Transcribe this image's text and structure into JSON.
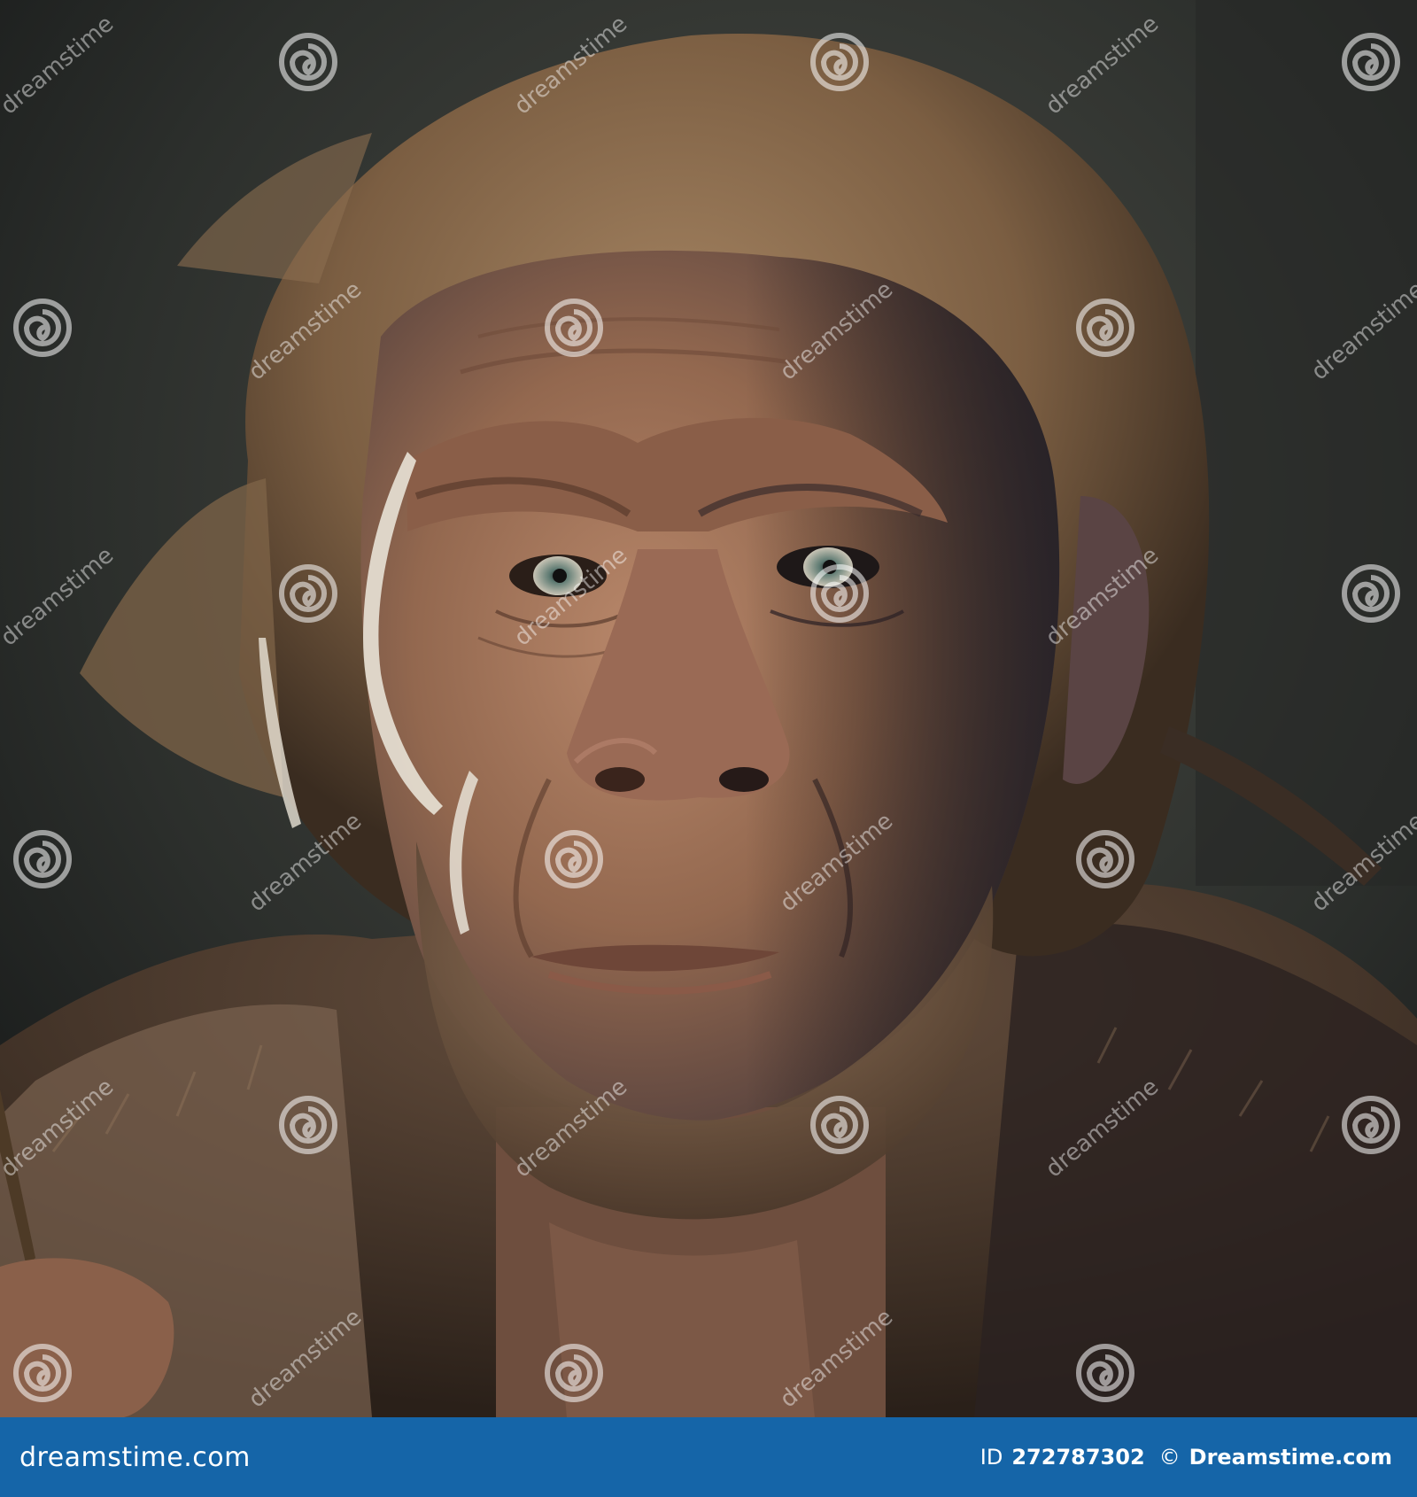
{
  "footer": {
    "site": "dreamstime.com",
    "id_label": "ID",
    "id_value": "272787302",
    "copyright": "©",
    "brand": "Dreamstime.com"
  },
  "watermark": {
    "text": "dreamstime"
  },
  "colors": {
    "footer_background": "#1565a8",
    "footer_text": "#ffffff",
    "background_dark": "#1a1c1c",
    "skin": "#a77a5c",
    "hair": "#8a6a48",
    "fur": "#5a4535"
  },
  "icons": {
    "logo": "spiral-logo-icon",
    "watermark": "spiral-watermark-icon"
  }
}
